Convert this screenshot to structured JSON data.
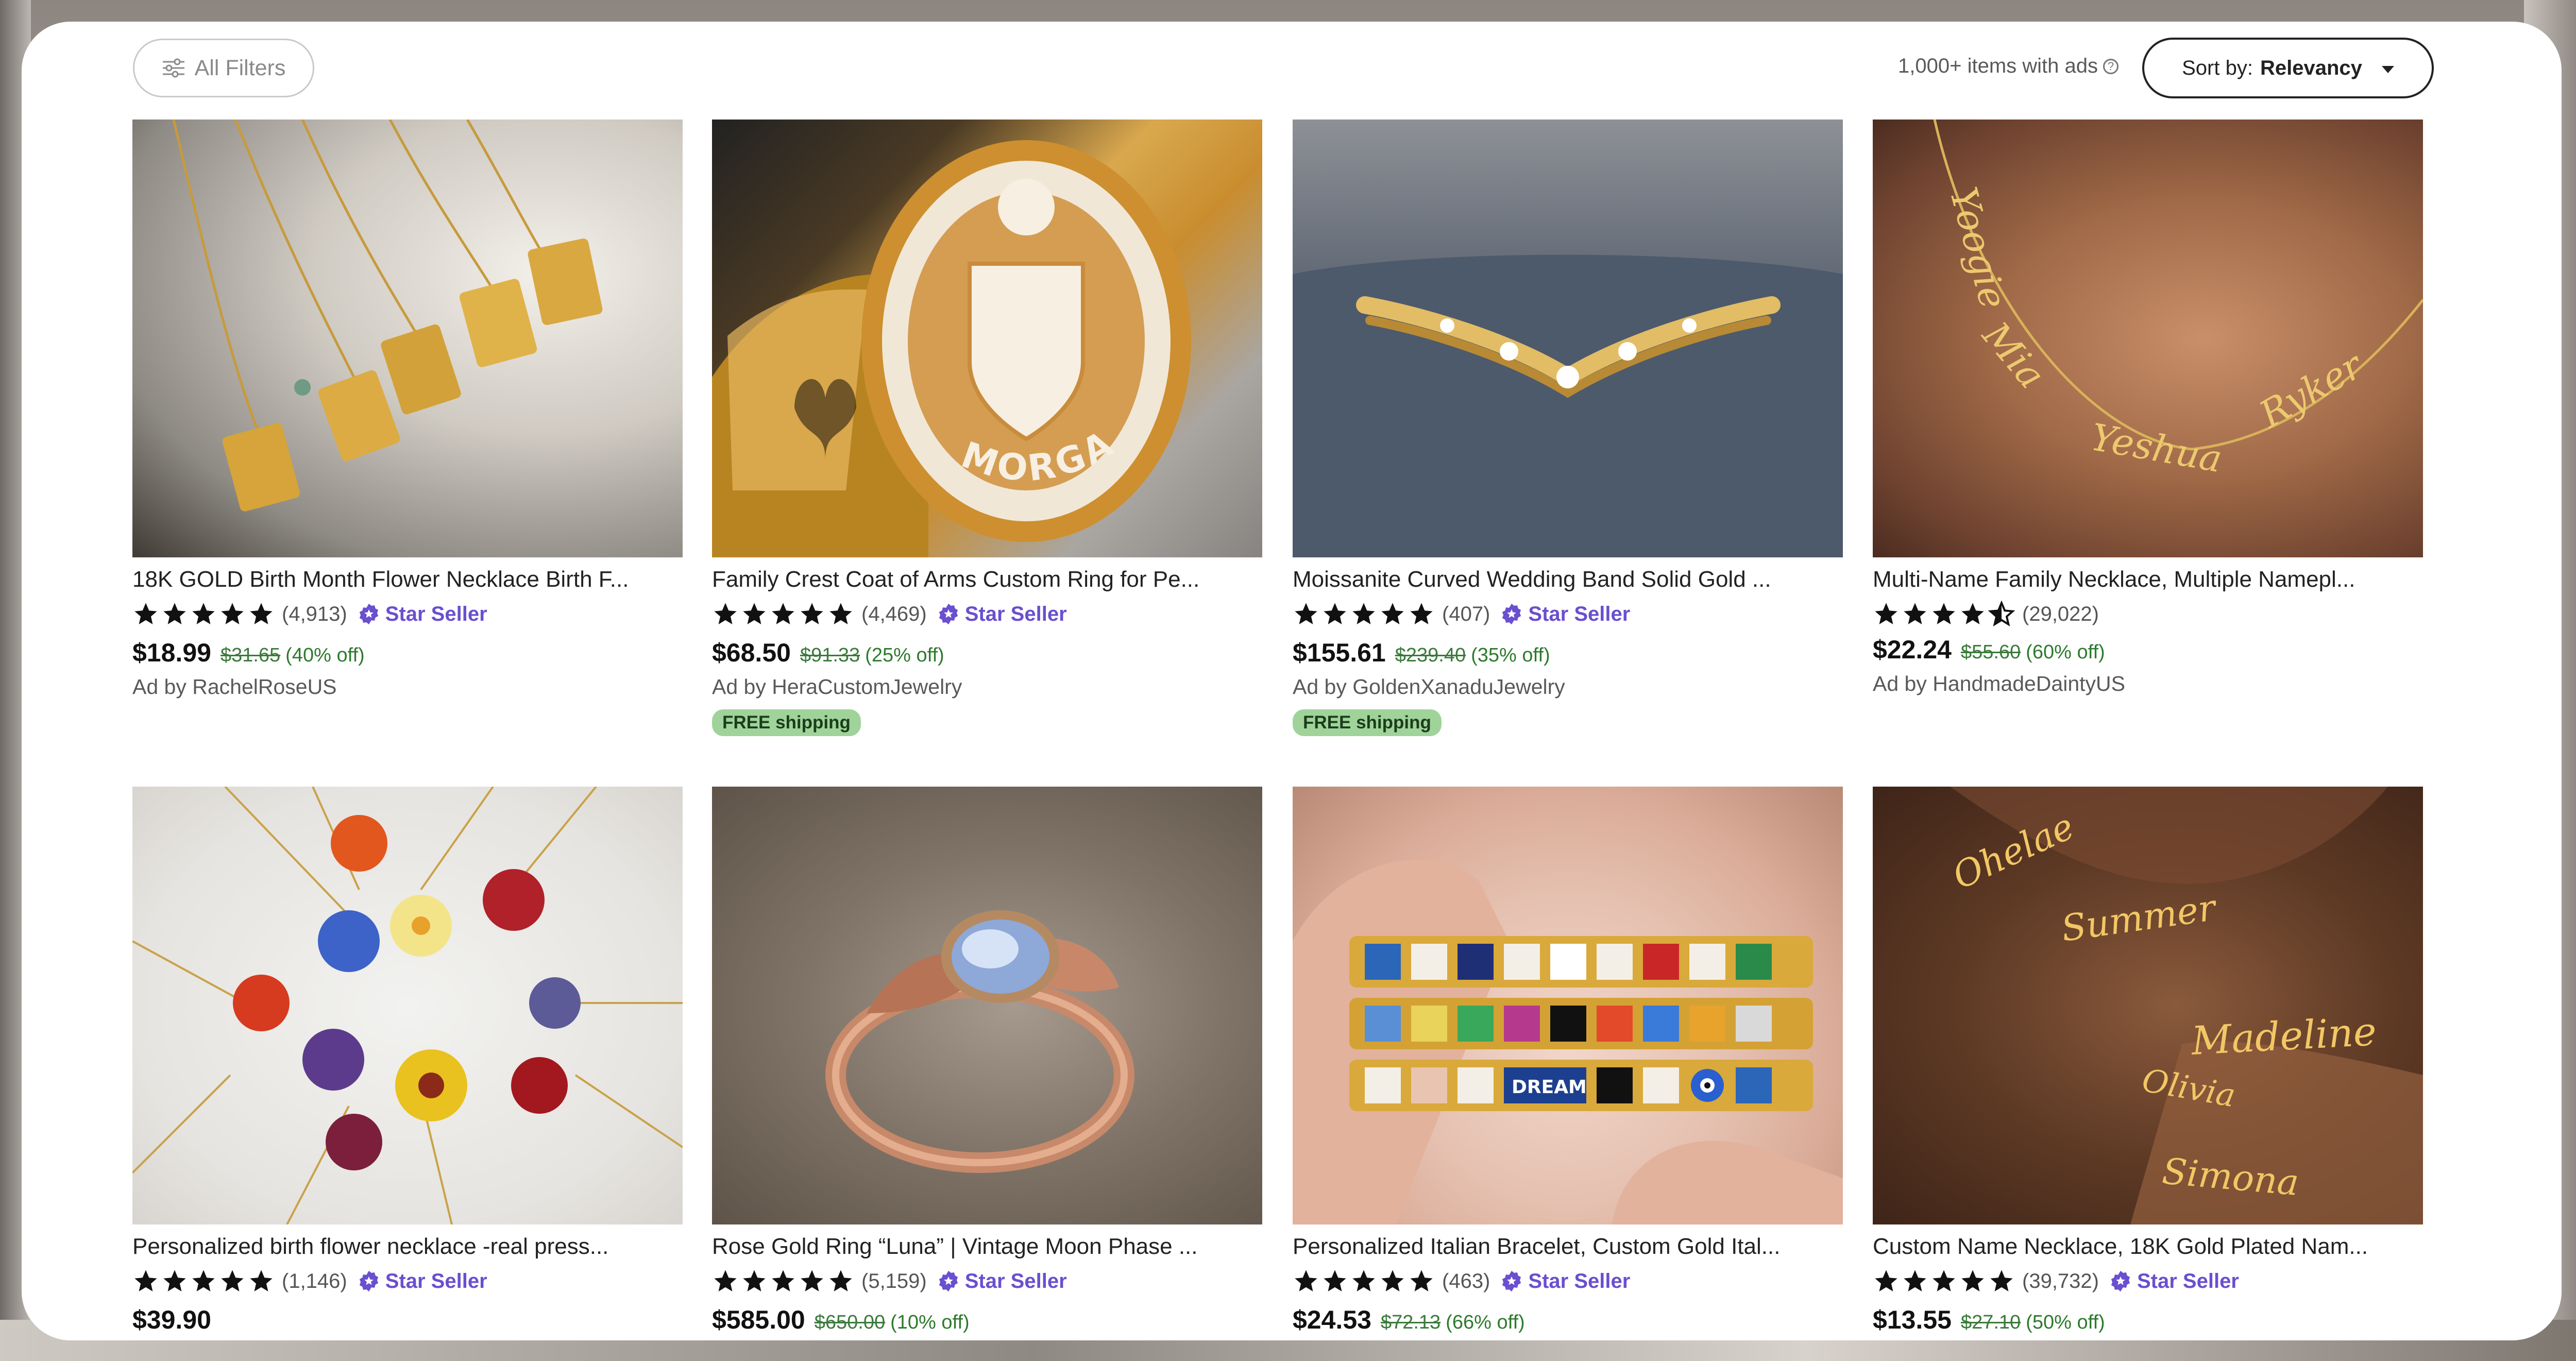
{
  "toolbar": {
    "filters_label": "All Filters",
    "results_text": "1,000+ items with ads",
    "help_symbol": "?",
    "sort_prefix": "Sort by:",
    "sort_value": "Relevancy"
  },
  "colors": {
    "star_seller": "#6a4fcf",
    "discount_green": "#2d7a2d",
    "free_shipping_bg": "#9fd39a"
  },
  "listings": [
    {
      "title": "18K GOLD Birth Month Flower Necklace Birth F...",
      "rating_count": "(4,913)",
      "rating": 5,
      "star_seller": "Star Seller",
      "price": "$18.99",
      "original_price": "$31.65",
      "discount": "(40% off)",
      "ad_by": "Ad by RachelRoseUS",
      "free_shipping": ""
    },
    {
      "title": "Family Crest Coat of Arms Custom Ring for Pe...",
      "rating_count": "(4,469)",
      "rating": 5,
      "star_seller": "Star Seller",
      "price": "$68.50",
      "original_price": "$91.33",
      "discount": "(25% off)",
      "ad_by": "Ad by HeraCustomJewelry",
      "free_shipping": "FREE shipping",
      "image_text": "MORGAN"
    },
    {
      "title": "Moissanite Curved Wedding Band Solid Gold ...",
      "rating_count": "(407)",
      "rating": 5,
      "star_seller": "Star Seller",
      "price": "$155.61",
      "original_price": "$239.40",
      "discount": "(35% off)",
      "ad_by": "Ad by GoldenXanaduJewelry",
      "free_shipping": "FREE shipping"
    },
    {
      "title": "Multi-Name Family Necklace, Multiple Namepl...",
      "rating_count": "(29,022)",
      "rating": 4.5,
      "star_seller": "",
      "price": "$22.24",
      "original_price": "$55.60",
      "discount": "(60% off)",
      "ad_by": "Ad by HandmadeDaintyUS",
      "free_shipping": "",
      "image_names": [
        "Yoogie",
        "Mia",
        "Yeshua",
        "Ryker"
      ]
    },
    {
      "title": "Personalized birth flower necklace -real press...",
      "rating_count": "(1,146)",
      "rating": 5,
      "star_seller": "Star Seller",
      "price": "$39.90",
      "original_price": "",
      "discount": "",
      "ad_by": "",
      "free_shipping": ""
    },
    {
      "title": "Rose Gold Ring “Luna” | Vintage Moon Phase ...",
      "rating_count": "(5,159)",
      "rating": 5,
      "star_seller": "Star Seller",
      "price": "$585.00",
      "original_price": "$650.00",
      "discount": "(10% off)",
      "ad_by": "",
      "free_shipping": ""
    },
    {
      "title": "Personalized Italian Bracelet, Custom Gold Ital...",
      "rating_count": "(463)",
      "rating": 5,
      "star_seller": "Star Seller",
      "price": "$24.53",
      "original_price": "$72.13",
      "discount": "(66% off)",
      "ad_by": "",
      "free_shipping": "",
      "image_text": "DREAM"
    },
    {
      "title": "Custom Name Necklace, 18K Gold Plated Nam...",
      "rating_count": "(39,732)",
      "rating": 5,
      "star_seller": "Star Seller",
      "price": "$13.55",
      "original_price": "$27.10",
      "discount": "(50% off)",
      "ad_by": "",
      "free_shipping": "",
      "image_names": [
        "Ohelae",
        "Summer",
        "Madeline",
        "Olivia",
        "Simona"
      ]
    }
  ]
}
